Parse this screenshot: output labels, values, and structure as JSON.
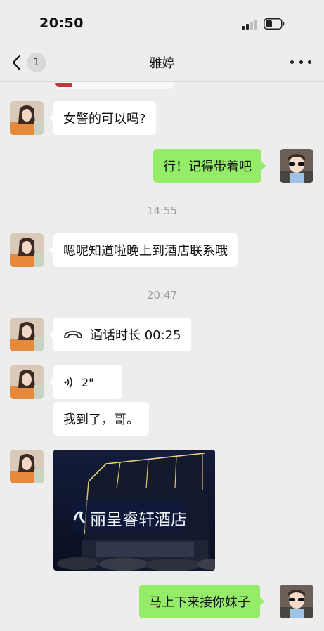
{
  "status_bar": {
    "time": "20:50",
    "signal_icon": "signal-bars-icon",
    "battery_icon": "battery-icon"
  },
  "nav": {
    "back_icon": "chevron-left-icon",
    "unread_count": "1",
    "title": "雅婷",
    "more_icon": "more-dots-icon"
  },
  "messages": [
    {
      "from": "contact",
      "text": "女警的可以吗?"
    },
    {
      "from": "me",
      "text": "行！记得带着吧"
    },
    {
      "type": "time",
      "text": "14:55"
    },
    {
      "from": "contact",
      "text": "嗯呢知道啦晚上到酒店联系哦"
    },
    {
      "type": "time",
      "text": "20:47"
    },
    {
      "from": "contact",
      "type": "call",
      "icon": "phone-icon",
      "text": "通话时长 00:25"
    },
    {
      "from": "contact",
      "type": "voice",
      "icon": "voice-wave-icon",
      "text": "2\""
    },
    {
      "from": "contact",
      "text": "我到了，哥。"
    },
    {
      "from": "contact",
      "type": "image",
      "image_text": "丽呈睿轩酒店"
    },
    {
      "from": "me",
      "text": "马上下来接你妹子"
    }
  ],
  "colors": {
    "background": "#ededed",
    "incoming_bubble": "#ffffff",
    "outgoing_bubble": "#95ec69",
    "timestamp": "#9a9a9a"
  }
}
